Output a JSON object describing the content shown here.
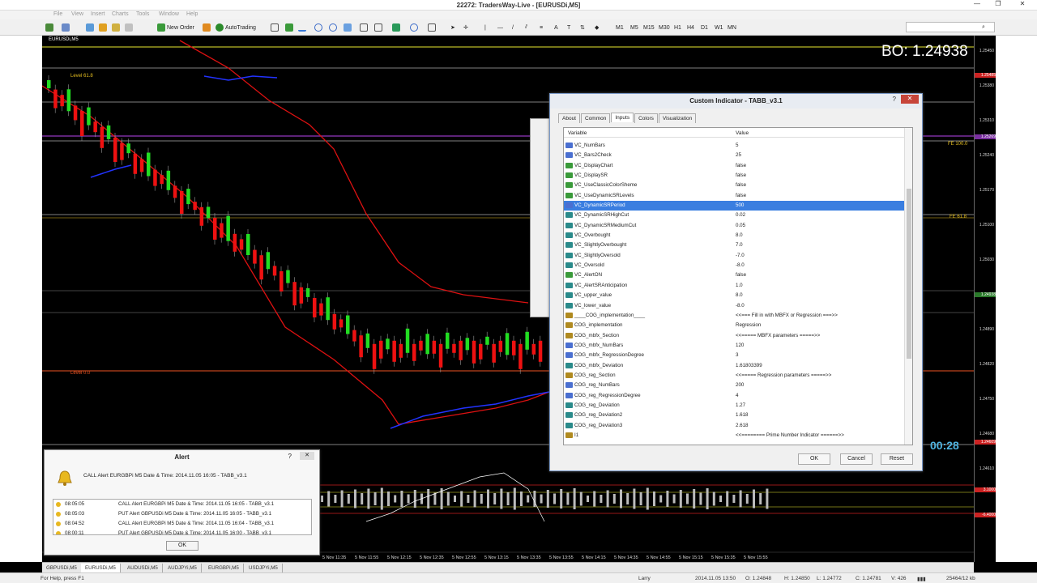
{
  "window": {
    "title": "22272: TradersWay-Live - [EURUSDi,M5]",
    "minimize": "—",
    "maximize": "❐",
    "close": "✕"
  },
  "menu": [
    "File",
    "View",
    "Insert",
    "Charts",
    "Tools",
    "Window",
    "Help"
  ],
  "toolbar": {
    "new_order": "New Order",
    "autotrading": "AutoTrading",
    "timeframes": [
      "M1",
      "M5",
      "M15",
      "M30",
      "H1",
      "H4",
      "D1",
      "W1",
      "MN"
    ]
  },
  "chart": {
    "symbol_label": "EURUSDi,M5",
    "level_618": "Level 61.8",
    "level_0": "Level 0.0",
    "fe_100": "FE 100.0",
    "fe_618": "FE 61.8",
    "bo_label": "BO: 1.24938",
    "timer": "00:28",
    "price_scale": [
      "1.25450",
      "1.25380",
      "1.25310",
      "1.25240",
      "1.25170",
      "1.25100",
      "1.25030",
      "1.24960",
      "1.24890",
      "1.24820",
      "1.24750",
      "1.24680",
      "1.24610"
    ],
    "price_tags": [
      {
        "text": "1.25485",
        "color": "#cc2222"
      },
      {
        "text": "1.25269",
        "color": "#7a2fa0"
      },
      {
        "text": "1.24938",
        "color": "#2a7a2a"
      },
      {
        "text": "1.24609",
        "color": "#cc2222"
      },
      {
        "text": "3.1000",
        "color": "#cc2222"
      },
      {
        "text": "-6.4000",
        "color": "#cc2222"
      }
    ],
    "time_labels": [
      "5 Nov 11:35",
      "5 Nov 11:55",
      "5 Nov 12:15",
      "5 Nov 12:35",
      "5 Nov 12:55",
      "5 Nov 13:15",
      "5 Nov 13:35",
      "5 Nov 13:55",
      "5 Nov 14:15",
      "5 Nov 14:35",
      "5 Nov 14:55",
      "5 Nov 15:15",
      "5 Nov 15:35",
      "5 Nov 15:55"
    ]
  },
  "indicator_dialog": {
    "title": "Custom Indicator - TABB_v3.1",
    "help": "?",
    "close": "✕",
    "tabs": [
      "About",
      "Common",
      "Inputs",
      "Colors",
      "Visualization"
    ],
    "active_tab": "Inputs",
    "col_variable": "Variable",
    "col_value": "Value",
    "rows": [
      {
        "var": "VC_NumBars",
        "val": "5",
        "type": "num"
      },
      {
        "var": "VC_Bars2Check",
        "val": "25",
        "type": "num"
      },
      {
        "var": "VC_DisplayChart",
        "val": "false",
        "type": "bool"
      },
      {
        "var": "VC_DisplaySR",
        "val": "false",
        "type": "bool"
      },
      {
        "var": "VC_UseClassicColorSheme",
        "val": "false",
        "type": "bool"
      },
      {
        "var": "VC_UseDynamicSRLevels",
        "val": "false",
        "type": "bool"
      },
      {
        "var": "VC_DynamicSRPeriod",
        "val": "500",
        "type": "num",
        "selected": true
      },
      {
        "var": "VC_DynamicSRHighCut",
        "val": "0.02",
        "type": "dbl"
      },
      {
        "var": "VC_DynamicSRMediumCut",
        "val": "0.05",
        "type": "dbl"
      },
      {
        "var": "VC_Overbought",
        "val": "8.0",
        "type": "dbl"
      },
      {
        "var": "VC_SlightlyOverbought",
        "val": "7.0",
        "type": "dbl"
      },
      {
        "var": "VC_SlightlyOversold",
        "val": "-7.0",
        "type": "dbl"
      },
      {
        "var": "VC_Oversold",
        "val": "-8.0",
        "type": "dbl"
      },
      {
        "var": "VC_AlertON",
        "val": "false",
        "type": "bool"
      },
      {
        "var": "VC_AlertSRAnticipation",
        "val": "1.0",
        "type": "dbl"
      },
      {
        "var": "VC_upper_value",
        "val": "8.0",
        "type": "dbl"
      },
      {
        "var": "VC_lower_value",
        "val": "-8.0",
        "type": "dbl"
      },
      {
        "var": "____COG_implementation____",
        "val": "<<=== Fill in with MBFX or Regression ===>>",
        "type": "str"
      },
      {
        "var": "COG_implementation",
        "val": "Regression",
        "type": "str"
      },
      {
        "var": "COG_mbfx_Section",
        "val": "<<===== MBFX parameters =====>>",
        "type": "str"
      },
      {
        "var": "COG_mbfx_NumBars",
        "val": "120",
        "type": "num"
      },
      {
        "var": "COG_mbfx_RegressionDegree",
        "val": "3",
        "type": "num"
      },
      {
        "var": "COG_mbfx_Deviation",
        "val": "1.61803399",
        "type": "dbl"
      },
      {
        "var": "COG_reg_Section",
        "val": "<<===== Regression parameters =====>>",
        "type": "str"
      },
      {
        "var": "COG_reg_NumBars",
        "val": "200",
        "type": "num"
      },
      {
        "var": "COG_reg_RegressionDegree",
        "val": "4",
        "type": "num"
      },
      {
        "var": "COG_reg_Deviation",
        "val": "1.27",
        "type": "dbl"
      },
      {
        "var": "COG_reg_Deviation2",
        "val": "1.618",
        "type": "dbl"
      },
      {
        "var": "COG_reg_Deviation3",
        "val": "2.618",
        "type": "dbl"
      },
      {
        "var": "I1",
        "val": "<<======== Prime Number Indicator ======>>",
        "type": "str"
      }
    ],
    "ok": "OK",
    "cancel": "Cancel",
    "reset": "Reset"
  },
  "alert": {
    "title": "Alert",
    "help": "?",
    "close": "✕",
    "message": "CALL Alert EURGBPi M5 Date & Time: 2014.11.05 16:05 - TABB_v3.1",
    "list": [
      {
        "time": "08:05:05",
        "msg": "CALL Alert EURGBPi M5 Date & Time: 2014.11.05 16:05 - TABB_v3.1"
      },
      {
        "time": "08:05:03",
        "msg": "PUT Alert GBPUSDi M5 Date & Time: 2014.11.05 16:05 - TABB_v3.1"
      },
      {
        "time": "08:04:52",
        "msg": "CALL Alert EURGBPi M5 Date & Time: 2014.11.05 16:04 - TABB_v3.1"
      },
      {
        "time": "08:00:11",
        "msg": "PUT Alert GBPUSDi M5 Date & Time: 2014.11.05 16:00 - TABB_v3.1"
      }
    ],
    "ok": "OK"
  },
  "symbol_tabs": [
    "GBPUSDi,M5",
    "EURUSDi,M5",
    "AUDUSDi,M5",
    "AUDJPYi,M5",
    "EURGBPi,M5",
    "USDJPYi,M5"
  ],
  "active_symbol_tab": "EURUSDi,M5",
  "status": {
    "help": "For Help, press F1",
    "profile": "Larry",
    "datetime": "2014.11.05 13:50",
    "open": "O: 1.24848",
    "high": "H: 1.24850",
    "low": "L: 1.24772",
    "close": "C: 1.24781",
    "volume": "V: 426",
    "traffic": "25464/12 kb"
  },
  "colors": {
    "bull": "#22dd22",
    "bear": "#ee1111",
    "band_red": "#dd1111",
    "band_blue": "#2233ff",
    "accent_select": "#3a7ee0"
  }
}
